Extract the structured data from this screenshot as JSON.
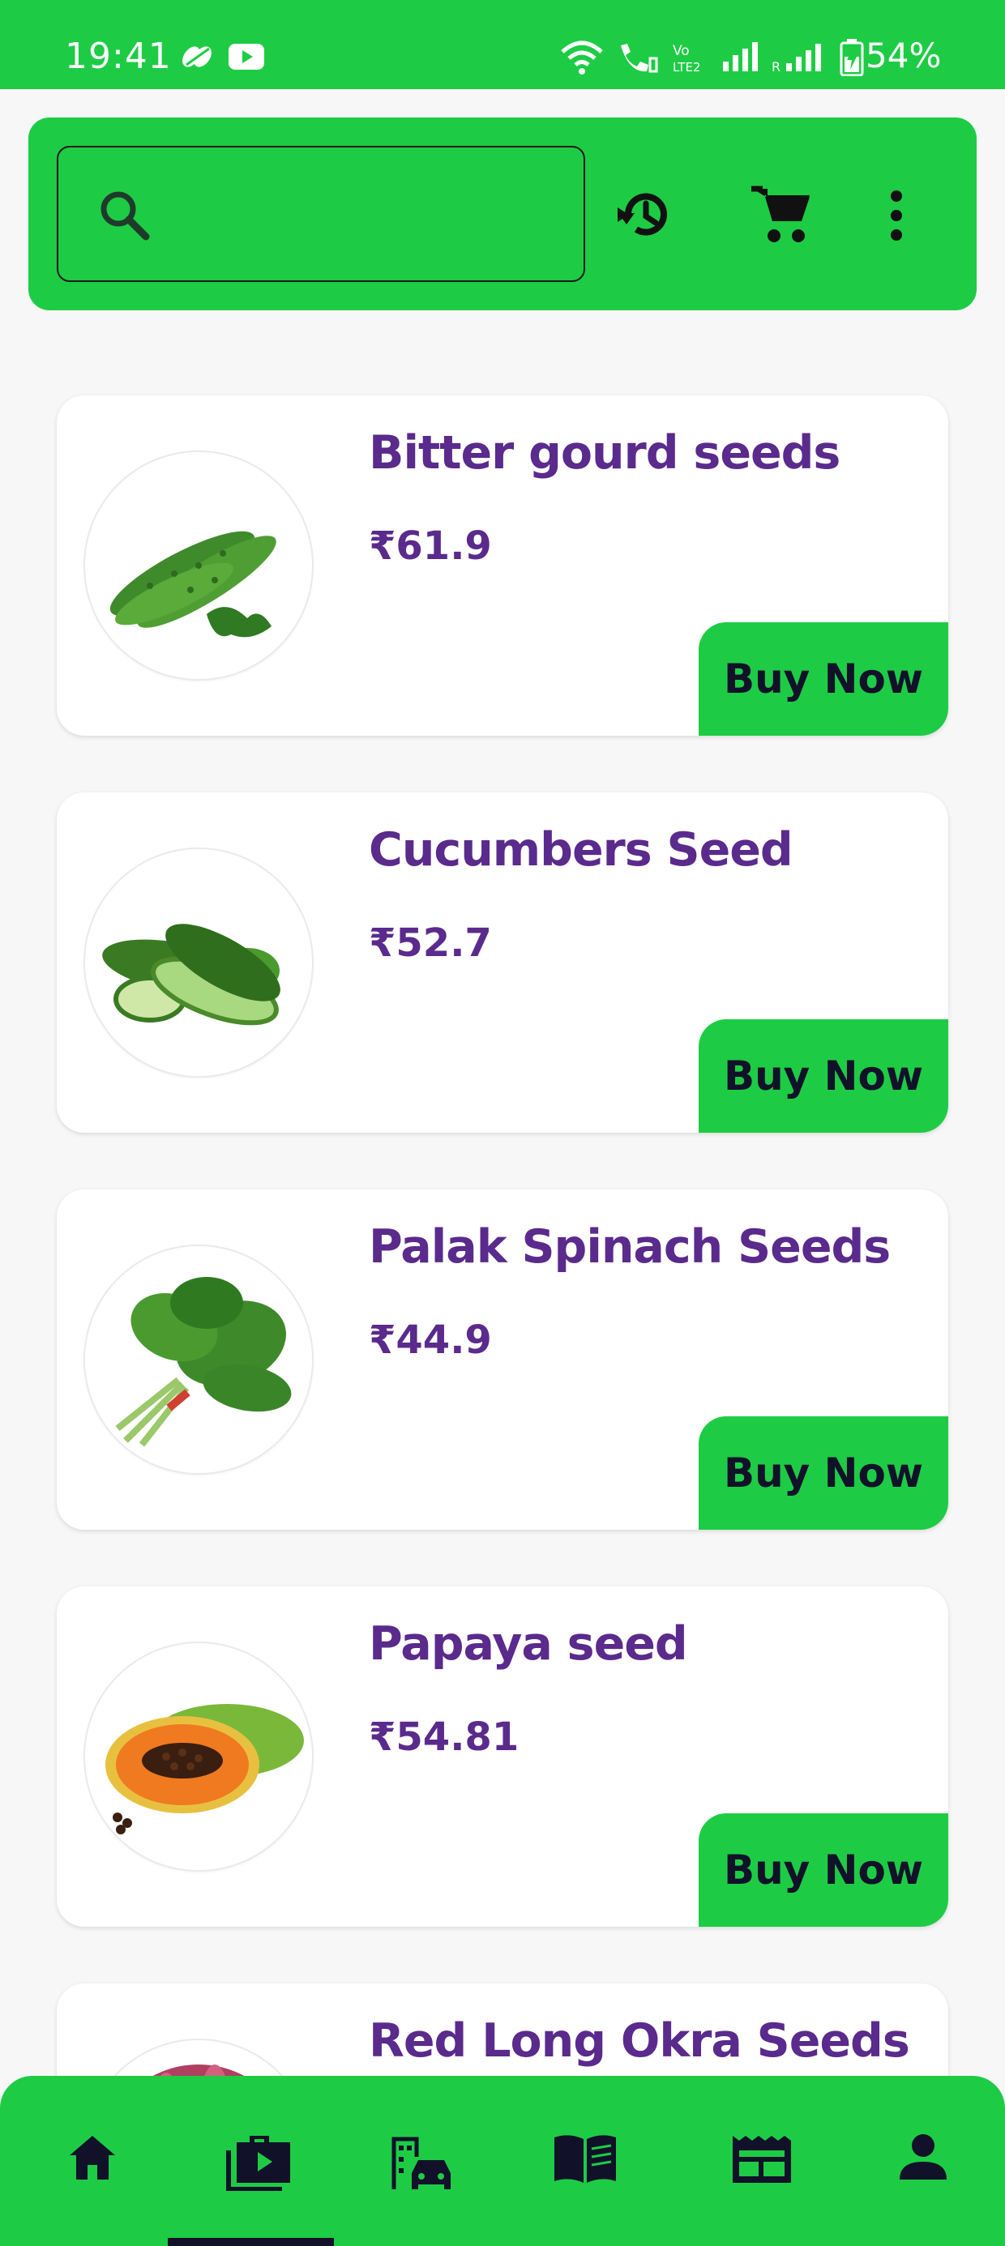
{
  "status_bar": {
    "time": "19:41",
    "battery": "54%"
  },
  "search": {
    "placeholder": "",
    "value": ""
  },
  "products": [
    {
      "name": "Bitter gourd seeds",
      "price": "₹61.9",
      "buy_label": "Buy Now",
      "icon": "bitter-gourd"
    },
    {
      "name": "Cucumbers Seed",
      "price": "₹52.7",
      "buy_label": "Buy Now",
      "icon": "cucumber"
    },
    {
      "name": "Palak Spinach Seeds",
      "price": "₹44.9",
      "buy_label": "Buy Now",
      "icon": "spinach"
    },
    {
      "name": "Papaya seed",
      "price": "₹54.81",
      "buy_label": "Buy Now",
      "icon": "papaya"
    },
    {
      "name": "Red Long Okra Seeds",
      "price": "",
      "buy_label": "",
      "icon": "okra"
    }
  ],
  "bottom_nav": {
    "items": [
      "home-icon",
      "briefcase-play-icon",
      "city-car-icon",
      "book-icon",
      "newspaper-icon",
      "person-icon"
    ],
    "active_index": 1
  },
  "colors": {
    "accent_green": "#1dcc44",
    "title_purple": "#5a2a8c",
    "dark_navy": "#11112a",
    "background": "#f7f7f7"
  }
}
